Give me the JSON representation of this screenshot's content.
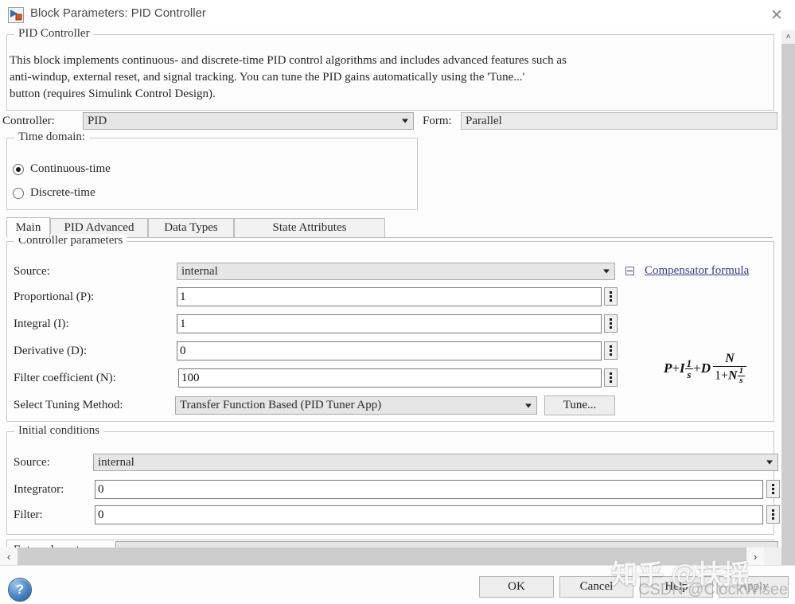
{
  "window": {
    "title": "Block Parameters: PID Controller",
    "icon": "simulink-block-icon",
    "close_label": "✕"
  },
  "description_group": {
    "title": "PID Controller",
    "line1": "This block implements continuous- and discrete-time PID control algorithms and includes advanced features such as",
    "line2": "anti-windup, external reset, and signal tracking. You can tune the PID gains automatically using the 'Tune...'",
    "line3": "button (requires Simulink Control Design)."
  },
  "controller_row": {
    "controller_label": "Controller:",
    "controller_value": "PID",
    "form_label": "Form:",
    "form_value": "Parallel"
  },
  "time_domain": {
    "title": "Time domain:",
    "options": [
      {
        "label": "Continuous-time",
        "selected": true
      },
      {
        "label": "Discrete-time",
        "selected": false
      }
    ]
  },
  "tabs": [
    {
      "label": "Main",
      "active": true
    },
    {
      "label": "PID Advanced",
      "active": false
    },
    {
      "label": "Data Types",
      "active": false
    },
    {
      "label": "State Attributes",
      "active": false
    }
  ],
  "controller_parameters": {
    "title": "Controller parameters",
    "source_label": "Source:",
    "source_value": "internal",
    "fields": [
      {
        "label": "Proportional (P):",
        "value": "1"
      },
      {
        "label": "Integral (I):",
        "value": "1"
      },
      {
        "label": "Derivative (D):",
        "value": "0"
      },
      {
        "label": "Filter coefficient (N):",
        "value": "100"
      }
    ],
    "tuning_label": "Select Tuning Method:",
    "tuning_value": "Transfer Function Based (PID Tuner App)",
    "tune_button": "Tune..."
  },
  "compensator": {
    "link_label": "Compensator formula",
    "collapse_icon": "minus-box-icon",
    "formula": {
      "p": "P",
      "plus1": "+",
      "i": "I",
      "i_num": "1",
      "i_den": "s",
      "plus2": "+",
      "d": "D",
      "d_num": "N",
      "d_den_one": "1+",
      "d_den_n": "N",
      "d_den_num": "1",
      "d_den_den": "s"
    }
  },
  "initial_conditions": {
    "title": "Initial conditions",
    "source_label": "Source:",
    "source_value": "internal",
    "integrator_label": "Integrator:",
    "integrator_value": "0",
    "filter_label": "Filter:",
    "filter_value": "0"
  },
  "external_reset": {
    "label": "External reset:"
  },
  "scrollbars": {
    "v_up": "˄",
    "h_left": "‹",
    "h_right": "›"
  },
  "footer": {
    "help_icon": "?",
    "buttons": [
      {
        "label": "OK",
        "disabled": false
      },
      {
        "label": "Cancel",
        "disabled": false
      },
      {
        "label": "Help",
        "disabled": false
      },
      {
        "label": "Apply",
        "disabled": true
      }
    ]
  },
  "watermarks": {
    "zhihu": "知乎 @扶摇",
    "csdn": "CSDN @ClockWisee"
  },
  "colors": {
    "link": "#3a3a8c",
    "combo_bg": "#e6e6e6",
    "window_bg": "#fdfdfd",
    "scroll_track": "#cdcdcd"
  }
}
